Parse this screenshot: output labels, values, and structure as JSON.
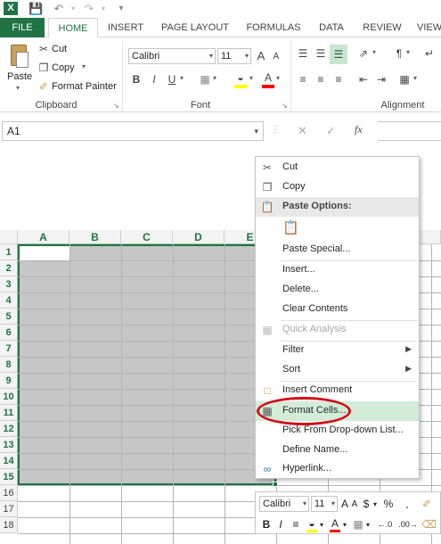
{
  "quick_access": {
    "logo": "X",
    "save_icon": "save-icon",
    "undo_icon": "undo-icon",
    "redo_icon": "redo-icon"
  },
  "tabs": [
    {
      "label": "FILE"
    },
    {
      "label": "HOME"
    },
    {
      "label": "INSERT"
    },
    {
      "label": "PAGE LAYOUT"
    },
    {
      "label": "FORMULAS"
    },
    {
      "label": "DATA"
    },
    {
      "label": "REVIEW"
    },
    {
      "label": "VIEW"
    }
  ],
  "clipboard": {
    "paste_label": "Paste",
    "cut_label": "Cut",
    "copy_label": "Copy",
    "format_painter_label": "Format Painter",
    "group_label": "Clipboard"
  },
  "font": {
    "font_name": "Calibri",
    "font_size": "11",
    "bold": "B",
    "italic": "I",
    "underline": "U",
    "grow": "A",
    "shrink": "A",
    "font_color": "A",
    "group_label": "Font"
  },
  "alignment": {
    "group_label": "Alignment"
  },
  "formula_bar": {
    "name_box": "A1",
    "fx_label": "fx"
  },
  "sheet": {
    "columns": [
      "A",
      "B",
      "C",
      "D",
      "E"
    ],
    "rows": [
      "1",
      "2",
      "3",
      "4",
      "5",
      "6",
      "7",
      "8",
      "9",
      "10",
      "11",
      "12",
      "13",
      "14",
      "15",
      "16",
      "17",
      "18"
    ]
  },
  "context_menu": {
    "items": [
      {
        "label": "Cut",
        "icon": "scissors-icon"
      },
      {
        "label": "Copy",
        "icon": "copy-icon"
      },
      {
        "label": "Paste Options:",
        "icon": "paste-icon"
      },
      {
        "label": "Paste Special...",
        "icon": ""
      },
      {
        "label": "Insert...",
        "icon": ""
      },
      {
        "label": "Delete...",
        "icon": ""
      },
      {
        "label": "Clear Contents",
        "icon": ""
      },
      {
        "label": "Quick Analysis",
        "icon": "quick-analysis-icon"
      },
      {
        "label": "Filter",
        "icon": ""
      },
      {
        "label": "Sort",
        "icon": ""
      },
      {
        "label": "Insert Comment",
        "icon": "comment-icon"
      },
      {
        "label": "Format Cells...",
        "icon": "format-cells-icon"
      },
      {
        "label": "Pick From Drop-down List...",
        "icon": ""
      },
      {
        "label": "Define Name...",
        "icon": ""
      },
      {
        "label": "Hyperlink...",
        "icon": "hyperlink-icon"
      }
    ]
  },
  "mini_toolbar": {
    "font_name": "Calibri",
    "font_size": "11",
    "bold": "B",
    "italic": "I",
    "currency": "$",
    "percent": "%",
    "grow": "A",
    "shrink": "A",
    "font_color": "A"
  },
  "colors": {
    "accent": "#217346",
    "highlight": "#d3ecd9",
    "oval": "#d0121b",
    "selection": "#c6c6c6"
  }
}
